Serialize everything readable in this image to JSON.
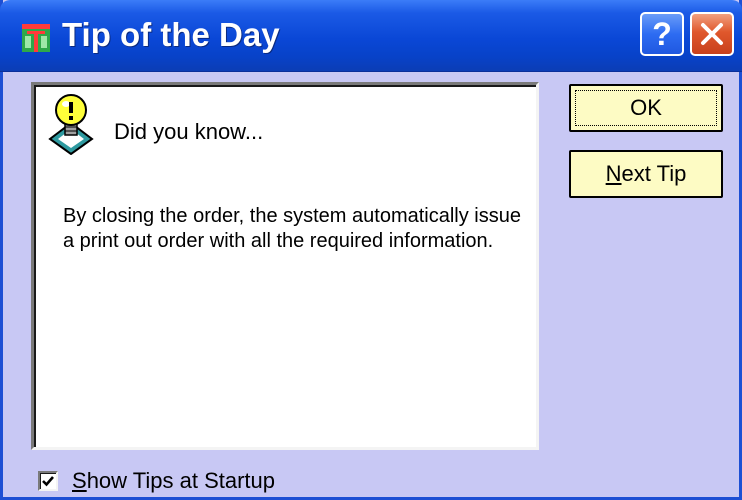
{
  "window": {
    "title": "Tip of the Day",
    "title_icon": "tip-of-the-day-icon",
    "help_label": "?",
    "colors": {
      "titlebar": "#0842c8",
      "dialog_body": "#c8c8f4",
      "button_face": "#fdfbc4",
      "close_button": "#e0582c"
    }
  },
  "tip": {
    "icon": "lightbulb-icon",
    "heading": "Did you know...",
    "text": "By closing the order, the system automatically issue a print out order with all the required information."
  },
  "buttons": {
    "ok_label": "OK",
    "next_tip_accel": "N",
    "next_tip_rest": "ext Tip"
  },
  "startup": {
    "checked": true,
    "label_accel": "S",
    "label_rest": "how Tips at Startup"
  }
}
